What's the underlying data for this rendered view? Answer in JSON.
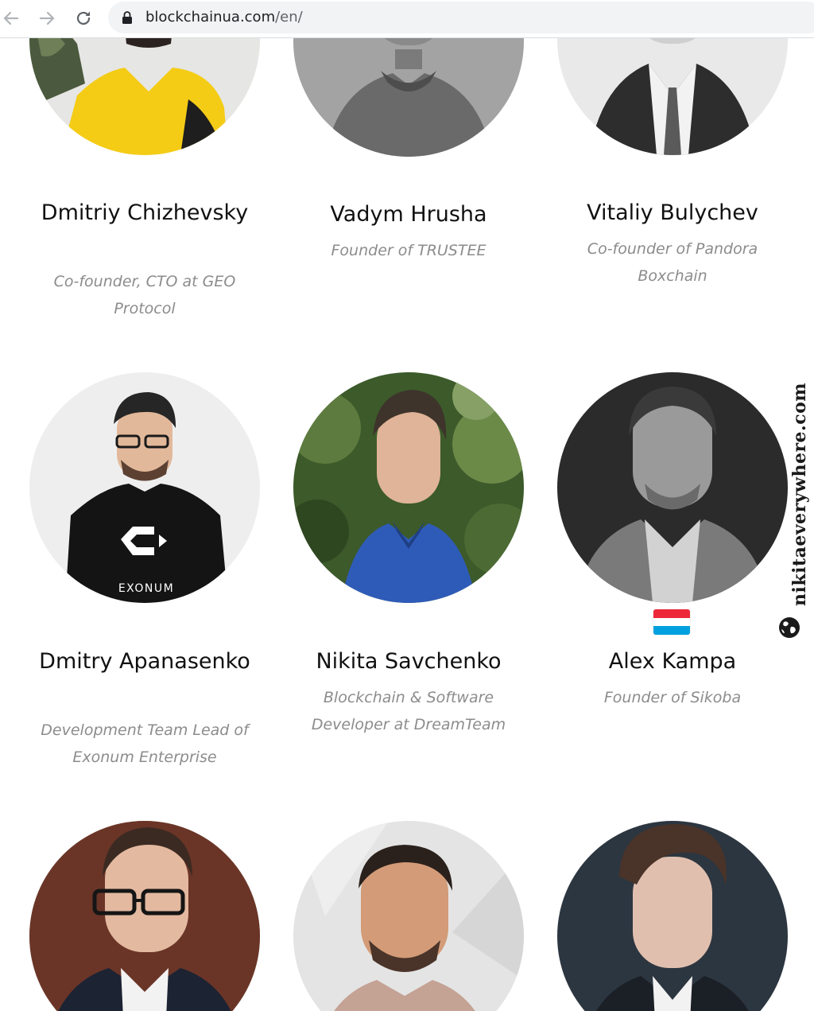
{
  "browser": {
    "url_host": "blockchainua.com",
    "url_path": "/en/"
  },
  "team": [
    {
      "name": "Dmitriy Chizhevsky",
      "role": "Co-founder, CTO at GEO Protocol"
    },
    {
      "name": "Vadym Hrusha",
      "role": "Founder of TRUSTEE"
    },
    {
      "name": "Vitaliy Bulychev",
      "role": "Co-founder of Pandora Boxchain"
    },
    {
      "name": "Dmitry Apanasenko",
      "role": "Development Team Lead of Exonum Enterprise",
      "shirt_text": "EXONUM"
    },
    {
      "name": "Nikita Savchenko",
      "role": "Blockchain & Software Developer at DreamTeam"
    },
    {
      "name": "Alex Kampa",
      "role": "Founder of Sikoba",
      "flag": "luxembourg-flag"
    }
  ],
  "watermark": "nikitaeverywhere.com",
  "colors": {
    "name_text": "#111111",
    "role_text": "#8c8c8c",
    "omnibox_bg": "#f1f3f4",
    "flag_red": "#ed2939",
    "flag_white": "#ffffff",
    "flag_blue": "#00a1de"
  },
  "icons": [
    "back-arrow-icon",
    "forward-arrow-icon",
    "reload-icon",
    "lock-icon",
    "globe-icon"
  ]
}
